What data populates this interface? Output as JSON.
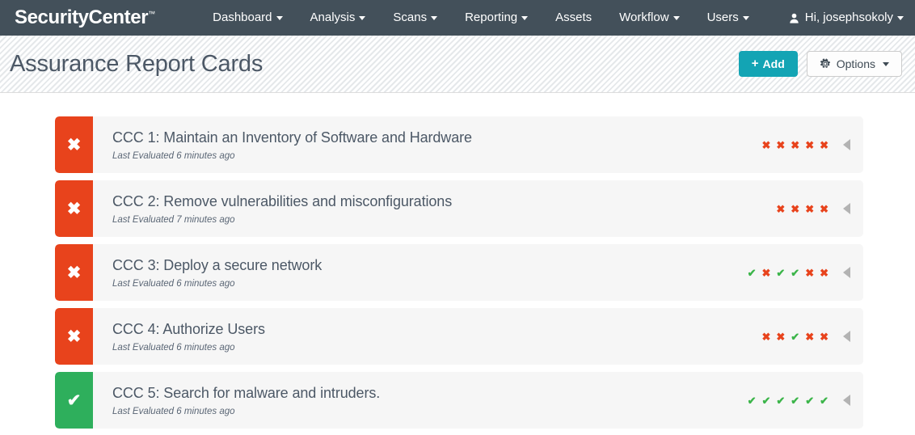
{
  "navbar": {
    "brand": "SecurityCenter",
    "brand_tm": "™",
    "items": [
      {
        "label": "Dashboard",
        "has_caret": true
      },
      {
        "label": "Analysis",
        "has_caret": true
      },
      {
        "label": "Scans",
        "has_caret": true
      },
      {
        "label": "Reporting",
        "has_caret": true
      },
      {
        "label": "Assets",
        "has_caret": false
      },
      {
        "label": "Workflow",
        "has_caret": true
      },
      {
        "label": "Users",
        "has_caret": true
      }
    ],
    "user_greeting": "Hi, josephsokoly",
    "user_icon": "person-icon",
    "background_color": "#43505a"
  },
  "page_header": {
    "title": "Assurance Report Cards",
    "add_button": {
      "label": "Add",
      "plus": "+",
      "color": "#13a4b4"
    },
    "options_button": {
      "label": "Options",
      "icon": "gear-icon"
    }
  },
  "cards": [
    {
      "status": "fail",
      "badge_glyph": "✖",
      "title": "CCC 1: Maintain an Inventory of Software and Hardware",
      "subtitle": "Last Evaluated 6 minutes ago",
      "markers": [
        "fail",
        "fail",
        "fail",
        "fail",
        "fail"
      ]
    },
    {
      "status": "fail",
      "badge_glyph": "✖",
      "title": "CCC 2: Remove vulnerabilities and misconfigurations",
      "subtitle": "Last Evaluated 7 minutes ago",
      "markers": [
        "fail",
        "fail",
        "fail",
        "fail"
      ]
    },
    {
      "status": "fail",
      "badge_glyph": "✖",
      "title": "CCC 3: Deploy a secure network",
      "subtitle": "Last Evaluated 6 minutes ago",
      "markers": [
        "pass",
        "fail",
        "pass",
        "pass",
        "fail",
        "fail"
      ]
    },
    {
      "status": "fail",
      "badge_glyph": "✖",
      "title": "CCC 4: Authorize Users",
      "subtitle": "Last Evaluated 6 minutes ago",
      "markers": [
        "fail",
        "fail",
        "pass",
        "fail",
        "fail"
      ]
    },
    {
      "status": "pass",
      "badge_glyph": "✔",
      "title": "CCC 5: Search for malware and intruders.",
      "subtitle": "Last Evaluated 6 minutes ago",
      "markers": [
        "pass",
        "pass",
        "pass",
        "pass",
        "pass",
        "pass"
      ]
    }
  ],
  "glyphs": {
    "marker_fail": "✖",
    "marker_pass": "✔"
  },
  "colors": {
    "fail": "#e8431c",
    "pass": "#2eaf5c",
    "marker_pass": "#3cb54a",
    "accent": "#13a4b4",
    "navbar": "#43505a",
    "title_text": "#4c5866"
  }
}
